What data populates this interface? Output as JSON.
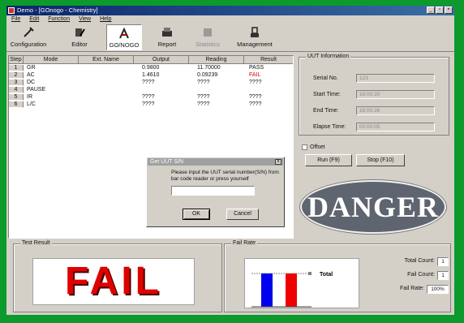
{
  "window": {
    "title": "Demo - [GOnogo - Chemistry]",
    "controls": {
      "minimize": "_",
      "restore": "▫",
      "close": "×"
    }
  },
  "menu": [
    "File",
    "Edit",
    "Function",
    "View",
    "Help"
  ],
  "toolbar": [
    {
      "label": "Configuration",
      "icon": "wrench-icon",
      "state": "normal"
    },
    {
      "label": "Editor",
      "icon": "edit-icon",
      "state": "normal"
    },
    {
      "label": "GO/NOGO",
      "icon": "gonogo-icon",
      "state": "active"
    },
    {
      "label": "Report",
      "icon": "printer-icon",
      "state": "normal"
    },
    {
      "label": "Statistics",
      "icon": "statistics-icon",
      "state": "disabled"
    },
    {
      "label": "Management",
      "icon": "management-icon",
      "state": "normal"
    }
  ],
  "table": {
    "headers": [
      "Step",
      "Mode",
      "Ext. Name",
      "Output",
      "Reading",
      "Result"
    ],
    "rows": [
      {
        "step": "1",
        "mode": "GR",
        "ext": "",
        "output": "0.9800",
        "reading": "11.70000",
        "result": "PASS"
      },
      {
        "step": "2",
        "mode": "AC",
        "ext": "",
        "output": "1.4610",
        "reading": "0.09239",
        "result": "FAIL"
      },
      {
        "step": "3",
        "mode": "DC",
        "ext": "",
        "output": "????",
        "reading": "????",
        "result": "????"
      },
      {
        "step": "4",
        "mode": "PAUSE",
        "ext": "",
        "output": "",
        "reading": "",
        "result": ""
      },
      {
        "step": "5",
        "mode": "IR",
        "ext": "",
        "output": "????",
        "reading": "????",
        "result": "????"
      },
      {
        "step": "6",
        "mode": "L/C",
        "ext": "",
        "output": "????",
        "reading": "????",
        "result": "????"
      }
    ]
  },
  "uut": {
    "legend": "UUT Information",
    "fields": [
      {
        "label": "Serial No.",
        "value": "123"
      },
      {
        "label": "Start Time:",
        "value": "16:00:20"
      },
      {
        "label": "End Time:",
        "value": "16:00:26"
      },
      {
        "label": "Elapse Time:",
        "value": "00:00:05"
      }
    ]
  },
  "offset_label": "Offset",
  "buttons": {
    "run": "Run (F9)",
    "stop": "Stop (F10)"
  },
  "danger_text": "DANGER",
  "dialog": {
    "title": "Get UUT S/N",
    "close": "x",
    "message": "Please input the UUT serial number(S/N) from bar code reader or press yourself",
    "ok": "OK",
    "cancel": "Cancel"
  },
  "test_result": {
    "legend": "Test Result",
    "value": "FAIL"
  },
  "fail_rate": {
    "legend": "Fail Rate",
    "chart_label": "Total",
    "counts": [
      {
        "label": "Total Count:",
        "value": "1"
      },
      {
        "label": "Fail Count:",
        "value": "1"
      },
      {
        "label": "Fail Rate:",
        "value": "100%"
      }
    ]
  },
  "colors": {
    "background": "#0c9a2c",
    "fail": "#e00000",
    "pass_bar": "#0000ee",
    "fail_bar": "#ee0000",
    "danger": "#5f6570"
  }
}
